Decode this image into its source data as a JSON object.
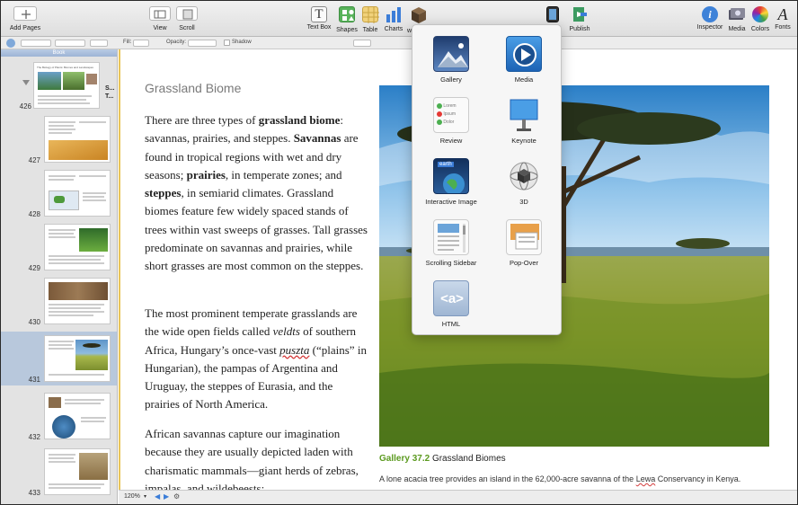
{
  "toolbar": {
    "add_pages": "Add Pages",
    "view": "View",
    "scroll": "Scroll",
    "text_box": "Text Box",
    "shapes": "Shapes",
    "table": "Table",
    "charts": "Charts",
    "preview_partial": "w",
    "publish": "Publish",
    "inspector": "Inspector",
    "media": "Media",
    "colors": "Colors",
    "fonts": "Fonts"
  },
  "format_bar": {
    "fill_label": "Fill:",
    "opacity_label": "Opacity:",
    "shadow_label": "Shadow"
  },
  "sidebar": {
    "header": "Book",
    "pages": [
      {
        "num": "426",
        "title": "S...",
        "title2": "T..."
      },
      {
        "num": "427"
      },
      {
        "num": "428"
      },
      {
        "num": "429"
      },
      {
        "num": "430"
      },
      {
        "num": "431"
      },
      {
        "num": "432"
      },
      {
        "num": "433"
      }
    ],
    "thumb_426_text": "The Biology of Plants: Biomes and Landscapes"
  },
  "document": {
    "heading": "Grassland Biome",
    "p1": {
      "t1": "There are three types of ",
      "b1": "grassland biome",
      "t2": ": savannas, prairies, and steppes. ",
      "b2": "Savannas",
      "t3": " are found in tropical regions with wet and dry seasons; ",
      "b3": "prairies",
      "t4": ", in temperate zones; and ",
      "b4": "steppes",
      "t5": ", in semiarid climates. Grassland biomes feature few widely spaced stands of trees within vast sweeps of grasses. Tall grasses predominate on savannas and prairies, while short grasses are most common on the steppes."
    },
    "p2": {
      "t1": "The most prominent temperate grasslands are the wide open fields called ",
      "i1": "veldts",
      "t2": " of southern Africa, Hungary’s once-vast ",
      "i2": "puszta",
      "t3": " (“plains” in Hungarian), the pampas of Argentina and Uruguay, the steppes of Eurasia, and the prairies of North America."
    },
    "p3": {
      "t1": "African savannas capture our imagination because they are usually depicted laden with charismatic mammals—giant herds of zebras, impalas, and wildebeests;"
    },
    "caption_num": "Gallery 37.2",
    "caption_title": "Grassland Biomes",
    "description_1": "A lone acacia tree provides an island in the 62,000-acre savanna of the ",
    "description_lewa": "Lewa",
    "description_2": " Conservancy in Kenya."
  },
  "status": {
    "zoom": "120%"
  },
  "widgets": {
    "items": [
      {
        "label": "Gallery"
      },
      {
        "label": "Media"
      },
      {
        "label": "Review",
        "lorem": "Lorem",
        "ipsum": "Ipsum",
        "dolor": "Dolor"
      },
      {
        "label": "Keynote"
      },
      {
        "label": "Interactive Image",
        "earth": "earth"
      },
      {
        "label": "3D"
      },
      {
        "label": "Scrolling Sidebar"
      },
      {
        "label": "Pop-Over"
      },
      {
        "label": "HTML",
        "tag": "<a>"
      }
    ]
  },
  "colors": {
    "caption_green": "#5b9a1f",
    "selected_page": "#b8c8dc",
    "sidebar_header": "#9db4d6"
  }
}
